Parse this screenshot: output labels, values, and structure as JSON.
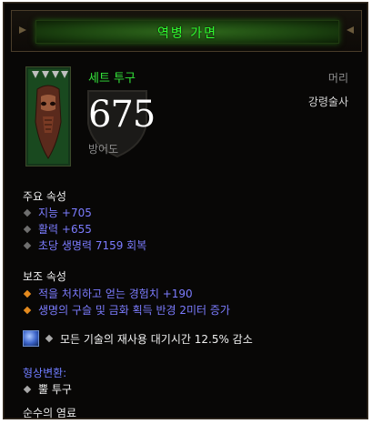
{
  "header": {
    "title": "역병 가면"
  },
  "item": {
    "set_label": "세트 투구",
    "slot": "머리",
    "class_restriction": "강령술사",
    "armor_value": "675",
    "armor_label": "방어도"
  },
  "primary": {
    "title": "주요 속성",
    "stats": [
      "지능 +705",
      "활력 +655",
      "초당 생명력 7159 회복"
    ]
  },
  "secondary": {
    "title": "보조 속성",
    "stats": [
      "적을 처치하고 얻는 경험치 +190",
      "생명의 구슬 및 금화 획득 반경 2미터 증가"
    ]
  },
  "gem": {
    "text": "모든 기술의 재사용 대기시간 12.5% 감소"
  },
  "transmog": {
    "title": "형상변환:",
    "item": "뿔 투구"
  },
  "flavor": "순수의 염료",
  "colors": {
    "set_green": "#34e63a",
    "magic_blue": "#7c7cff",
    "legendary_orange": "#e48a1e",
    "header_green": "#30ff30"
  },
  "icons": [
    "helm-item-icon",
    "shield-icon",
    "gem-socket-icon"
  ]
}
